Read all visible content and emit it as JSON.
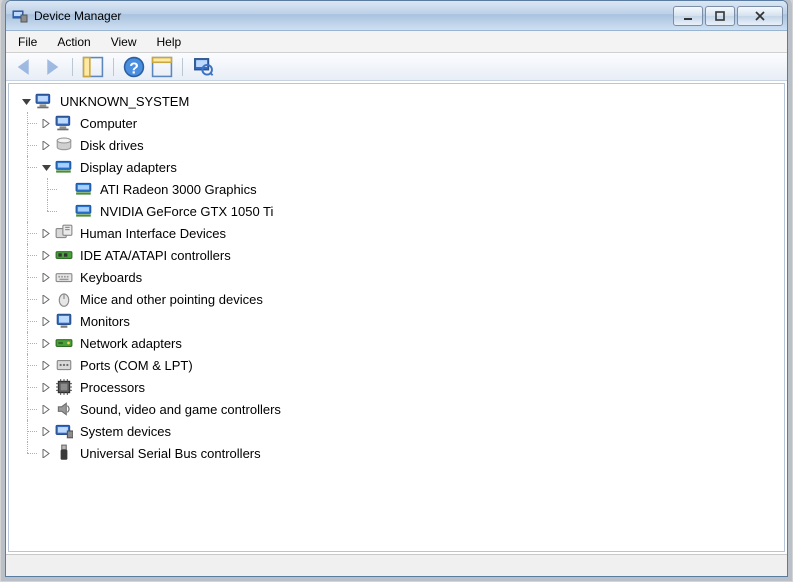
{
  "window": {
    "title": "Device Manager"
  },
  "menu": {
    "file": "File",
    "action": "Action",
    "view": "View",
    "help": "Help"
  },
  "toolbar": {
    "back": "back",
    "forward": "forward",
    "show_hide_tree": "show-hide-console-tree",
    "help": "help",
    "properties": "properties",
    "scan": "scan-hardware-changes"
  },
  "tree": {
    "root": {
      "label": "UNKNOWN_SYSTEM",
      "expanded": true,
      "icon": "computer"
    },
    "categories": [
      {
        "label": "Computer",
        "icon": "computer",
        "expanded": false,
        "children": []
      },
      {
        "label": "Disk drives",
        "icon": "disk",
        "expanded": false,
        "children": []
      },
      {
        "label": "Display adapters",
        "icon": "display",
        "expanded": true,
        "children": [
          {
            "label": "ATI Radeon 3000 Graphics",
            "icon": "display"
          },
          {
            "label": "NVIDIA GeForce GTX 1050 Ti",
            "icon": "display"
          }
        ]
      },
      {
        "label": "Human Interface Devices",
        "icon": "hid",
        "expanded": false,
        "children": []
      },
      {
        "label": "IDE ATA/ATAPI controllers",
        "icon": "ide",
        "expanded": false,
        "children": []
      },
      {
        "label": "Keyboards",
        "icon": "keyboard",
        "expanded": false,
        "children": []
      },
      {
        "label": "Mice and other pointing devices",
        "icon": "mouse",
        "expanded": false,
        "children": []
      },
      {
        "label": "Monitors",
        "icon": "monitor",
        "expanded": false,
        "children": []
      },
      {
        "label": "Network adapters",
        "icon": "network",
        "expanded": false,
        "children": []
      },
      {
        "label": "Ports (COM & LPT)",
        "icon": "port",
        "expanded": false,
        "children": []
      },
      {
        "label": "Processors",
        "icon": "cpu",
        "expanded": false,
        "children": []
      },
      {
        "label": "Sound, video and game controllers",
        "icon": "sound",
        "expanded": false,
        "children": []
      },
      {
        "label": "System devices",
        "icon": "system",
        "expanded": false,
        "children": []
      },
      {
        "label": "Universal Serial Bus controllers",
        "icon": "usb",
        "expanded": false,
        "children": []
      }
    ]
  }
}
